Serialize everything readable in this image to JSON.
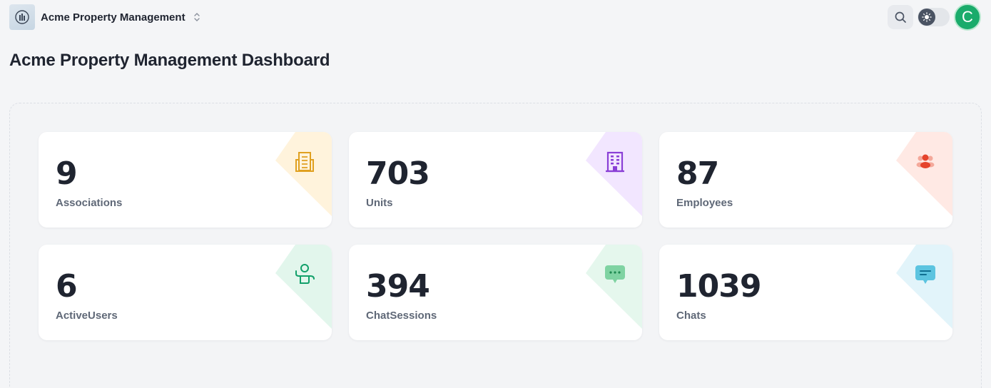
{
  "header": {
    "org_name": "Acme Property Management",
    "avatar_initial": "C",
    "avatar_color": "#1aab6b"
  },
  "page": {
    "title": "Acme Property Management Dashboard"
  },
  "stats": [
    {
      "value": "9",
      "label": "Associations",
      "icon": "building-icon",
      "accent": "#e0a020",
      "tint": "#fff3dc"
    },
    {
      "value": "703",
      "label": "Units",
      "icon": "apartment-icon",
      "accent": "#8a3fd6",
      "tint": "#f2e6ff"
    },
    {
      "value": "87",
      "label": "Employees",
      "icon": "employees-icon",
      "accent": "#e5432c",
      "tint": "#ffe9e4"
    },
    {
      "value": "6",
      "label": "ActiveUsers",
      "icon": "active-user-icon",
      "accent": "#12a06a",
      "tint": "#e2f6ec"
    },
    {
      "value": "394",
      "label": "ChatSessions",
      "icon": "chat-bubble-icon",
      "accent": "#3dbb78",
      "tint": "#e5f7ed"
    },
    {
      "value": "1039",
      "label": "Chats",
      "icon": "message-icon",
      "accent": "#1ea7cf",
      "tint": "#e2f4fa"
    }
  ]
}
